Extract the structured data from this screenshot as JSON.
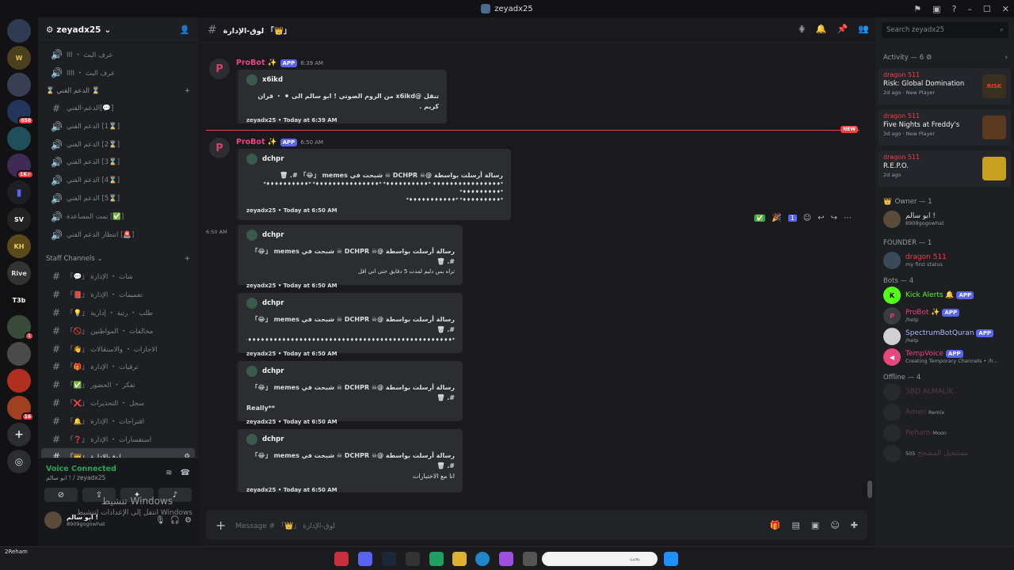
{
  "window": {
    "title": "zeyadx25"
  },
  "server": {
    "name": "zeyadx25"
  },
  "guild_badges": [
    "658",
    "1K+",
    "1",
    "16"
  ],
  "guild_labels": [
    "SV",
    "KH",
    "Rive",
    "T3b"
  ],
  "channels": [
    {
      "icon": "voice",
      "name": "عرف البث ・ III"
    },
    {
      "icon": "voice",
      "name": "عرف البث ・ IIII"
    },
    {
      "icon": "cat",
      "name": "⌛ الدعم الفني ⌛"
    },
    {
      "icon": "text",
      "name": "[💬]الدعم-الفني"
    },
    {
      "icon": "voice",
      "name": "[⌛1] الدعم الفني"
    },
    {
      "icon": "voice",
      "name": "[⌛2] الدعم الفني"
    },
    {
      "icon": "voice",
      "name": "[⌛3] الدعم الفني"
    },
    {
      "icon": "voice",
      "name": "[⌛4] الدعم الفني"
    },
    {
      "icon": "voice",
      "name": "[⌛5] الدعم الفني"
    },
    {
      "icon": "voice",
      "name": "[✅] تمت المساعدة"
    },
    {
      "icon": "voice",
      "name": "[🚨] انتظار الدعم الفني"
    }
  ],
  "staff_category": "Staff Channels",
  "staff_channels": [
    {
      "name": "شات ・ الإدارة 「💬」"
    },
    {
      "name": "تعميمات ・ الإدارة 「📕」"
    },
    {
      "name": "طلب ・ رتبة ・ إدارية 「💡」"
    },
    {
      "name": "مخالفات ・ المواطنين 「🚫」"
    },
    {
      "name": "الاجازات ・ والاستقالات 「👋」"
    },
    {
      "name": "ترقيات ・ الإدارة 「🎁」"
    },
    {
      "name": "تفكر ・ الحضور 「✅」"
    },
    {
      "name": "سجل ・ التحذيرات 「❌」"
    },
    {
      "name": "اقتراحات ・ الإدارة 「🔔」"
    },
    {
      "name": "استفسارات ・ الإدارة 「❓」"
    },
    {
      "name": "لوق-الإدارة 「👑」"
    }
  ],
  "voice": {
    "status": "Voice Connected",
    "sub": "ابو سالم ! / zeyadx25"
  },
  "user": {
    "name": "ابو سالم !",
    "status": "8909gogowhat"
  },
  "watermark": {
    "line1": "تنشيط Windows",
    "line2": "انتقل إلى الإعدادات لتنشيط Windows"
  },
  "header": {
    "channel": "لوق-الإدارة 「👑」"
  },
  "messages": [
    {
      "bot": "ProBot ✨",
      "app": "APP",
      "time": "6:39 AM",
      "author": "x6ikd",
      "desc": "تنقل @x6ikd من الروم الصوتي ! ابو سالم الى ⚫ ・ قران كريم .",
      "foot": "zeyadx25 • Today at 6:39 AM"
    },
    {
      "bot": "ProBot ✨",
      "app": "APP",
      "time": "6:50 AM",
      "author": "dchpr",
      "desc": "رسالة أرسلت بواسطة @☠ DCHPR ☠ شبحت في memes 「😂」 #. 🗑",
      "desc2": "*♦♦♦♦♦♦♦♦♦♦♦♦♦♦♦♦ *♦♦♦♦♦♦♦♦♦♦* *♦♦♦♦♦♦♦♦♦♦♦♦♦♦♦* *♦♦♦♦♦♦♦♦♦♦* *♦♦♦♦♦♦♦♦♦*",
      "desc3": "*♦♦♦♦♦♦♦♦♦* *♦♦♦♦♦♦♦♦♦♦♦*",
      "foot": "zeyadx25 • Today at 6:50 AM"
    }
  ],
  "new_badge": "NEW",
  "side_time": "6:50 AM",
  "cont": [
    {
      "author": "dchpr",
      "desc": "رسالة أرسلت بواسطة @☠ DCHPR ☠ شبحت في memes 「😂」 #. 🗑",
      "extra": "تراه بس دليم لمدت 5 دقايق حتى اني اقل",
      "foot": "zeyadx25 • Today at 6:50 AM"
    },
    {
      "author": "dchpr",
      "desc": "رسالة أرسلت بواسطة @☠ DCHPR ☠ شبحت في memes 「😂」 #. 🗑",
      "extra": "*♦♦♦♦♦♦♦♦♦♦♦♦♦♦♦♦♦♦♦♦♦♦♦♦♦♦♦♦♦♦♦♦♦♦♦♦♦♦♦♦♦♦♦♦♦♦♦♦♦♦♦♦♦♦♦♦♦♦♦♦♦*",
      "foot": "zeyadx25 • Today at 6:50 AM"
    },
    {
      "author": "dchpr",
      "desc": "رسالة أرسلت بواسطة @☠ DCHPR ☠ شبحت في memes 「😂」 #. 🗑",
      "extra": "Really**",
      "foot": "zeyadx25 • Today at 6:50 AM"
    },
    {
      "author": "dchpr",
      "desc": "رسالة أرسلت بواسطة @☠ DCHPR ☠ شبحت في memes 「😂」 #. 🗑",
      "extra": "انا مع الاختبارات",
      "foot": "zeyadx25 • Today at 6:50 AM"
    }
  ],
  "reactions": [
    "✅",
    "🎉",
    "1"
  ],
  "composer": {
    "placeholder": "Message # 「👑」 لوق-الإدارة"
  },
  "members": {
    "search": "Search zeyadx25",
    "activity": "Activity — 6",
    "activities": [
      {
        "name": "dragon 511",
        "game": "Risk: Global Domination",
        "meta": "2d ago · New Player",
        "img": "RISK"
      },
      {
        "name": "dragon 511",
        "game": "Five Nights at Freddy's",
        "meta": "3d ago · New Player",
        "img": ""
      },
      {
        "name": "dragon 511",
        "game": "R.E.P.O.",
        "meta": "2d ago",
        "img": ""
      }
    ],
    "owner_head": "Owner — 1",
    "owner": {
      "name": "ابو سالم !",
      "status": "8909gogowhat"
    },
    "founder_head": "FOUNDER — 1",
    "founder": {
      "name": "dragon 511",
      "status": "my first status"
    },
    "bots_head": "Bots — 4",
    "bots": [
      {
        "name": "Kick Alerts 🔔",
        "app": "APP",
        "status": ""
      },
      {
        "name": "ProBot ✨",
        "app": "APP",
        "status": "/help"
      },
      {
        "name": "SpectrumBotQuran",
        "app": "APP",
        "status": "/help"
      },
      {
        "name": "TempVoice",
        "app": "APP",
        "status": "Creating Temporary Channels • /h..."
      }
    ],
    "offline_head": "Offline — 4",
    "offline": [
      {
        "name": "3BD ALMALIK",
        "status": ""
      },
      {
        "name": "Amen",
        "status": "Remix"
      },
      {
        "name": "Reham",
        "status": "Moon"
      },
      {
        "name": "مستحيل المصحح",
        "status": "505"
      }
    ]
  },
  "taskbar": {
    "search": "بحث",
    "tray": "2Reham"
  }
}
